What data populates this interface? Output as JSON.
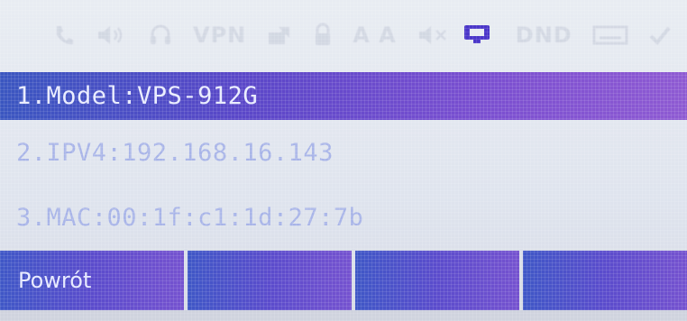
{
  "statusbar": {
    "icons": [
      "phone-icon",
      "speaker-icon",
      "headset-icon",
      "vpn-label",
      "forward-icon",
      "lock-icon",
      "text-size-icon",
      "mute-icon",
      "network-icon",
      "dnd-label",
      "voicemail-icon",
      "missed-call-icon"
    ],
    "vpn_text": "VPN",
    "aa_text": "A A",
    "dnd_text": "DND"
  },
  "menu": {
    "items": [
      {
        "label": "1.Model:VPS-912G",
        "selected": true
      },
      {
        "label": "2.IPV4:192.168.16.143",
        "selected": false
      },
      {
        "label": "3.MAC:00:1f:c1:1d:27:7b",
        "selected": false
      }
    ]
  },
  "softkeys": [
    {
      "label": "Powrót"
    },
    {
      "label": ""
    },
    {
      "label": ""
    },
    {
      "label": ""
    }
  ],
  "colors": {
    "accent_start": "#3a56c0",
    "accent_end": "#8e5ad2",
    "text_dim": "#a8b4e8"
  }
}
